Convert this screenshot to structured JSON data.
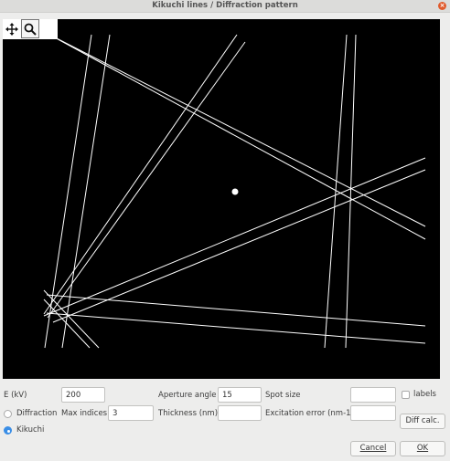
{
  "window": {
    "title": "Kikuchi lines / Diffraction pattern"
  },
  "plot": {
    "background": "#000000",
    "line_color": "#ffffff",
    "center_spot": "#ffffff"
  },
  "toolbar": {
    "pan_icon": "move-arrows-icon",
    "zoom_icon": "magnifier-icon"
  },
  "form": {
    "e_label": "E (kV)",
    "e_value": "200",
    "aperture_label": "Aperture angle",
    "aperture_value": "15",
    "spot_label": "Spot size",
    "spot_value": "",
    "labels_label": "labels",
    "labels_checked": false,
    "diffraction_label": "Diffraction",
    "kikuchi_label": "Kikuchi",
    "mode_selected": "Kikuchi",
    "max_indices_label": "Max indices",
    "max_indices_value": "3",
    "thickness_label": "Thickness (nm)",
    "thickness_value": "",
    "excitation_label": "Excitation error (nm-1)",
    "excitation_value": "",
    "diff_calc_label": "Diff calc.",
    "cancel_label": "Cancel",
    "ok_label": "OK"
  }
}
